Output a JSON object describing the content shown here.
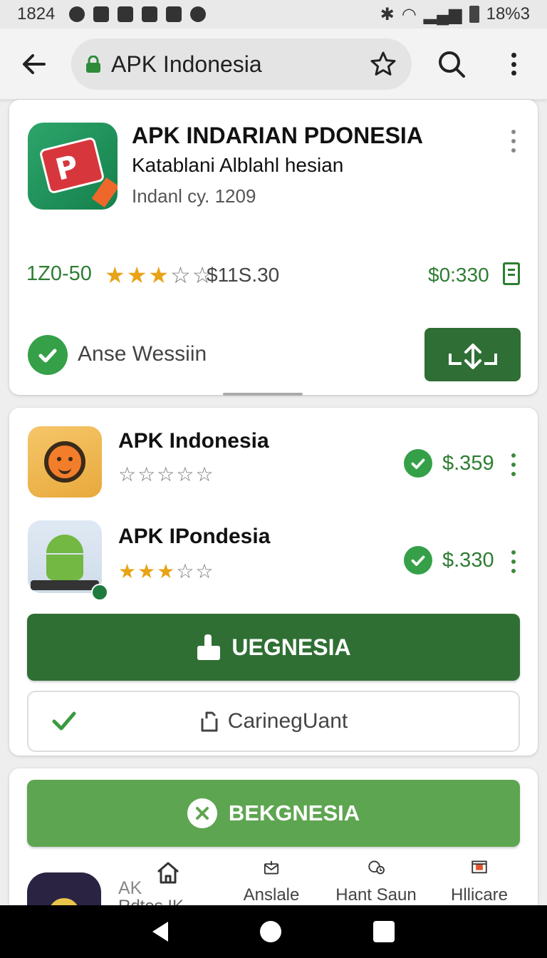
{
  "status_bar": {
    "time": "1824",
    "battery": "18%3"
  },
  "toolbar": {
    "url": "APK Indonesia"
  },
  "featured_app": {
    "title": "APK INDARIAN PDONESIA",
    "subtitle": "Katablani Alblahl hesian",
    "meta": "Indanl cy. 1209",
    "range": "1Z0-50",
    "rating": 3,
    "rating_max": 5,
    "price": "$11S.30",
    "alt_price": "$0:330",
    "status": "Anse Wessiin"
  },
  "app_list": [
    {
      "title": "APK Indonesia",
      "rating": 0,
      "rating_max": 5,
      "price": "$.359"
    },
    {
      "title": "APK IPondesia",
      "rating": 3,
      "rating_max": 5,
      "price": "$.330"
    }
  ],
  "buttons": {
    "primary": "UEGNESIA",
    "secondary": "CarinegUant",
    "cancel": "BEKGNESIA"
  },
  "peek_item": {
    "title": "AK",
    "subtitle": "Rdtes IK"
  },
  "bottom_nav": [
    {
      "label": "",
      "icon": "home-icon"
    },
    {
      "label": "Anslale",
      "icon": "mail-icon"
    },
    {
      "label": "Hant Saun",
      "icon": "clock-icon"
    },
    {
      "label": "Hllicare",
      "icon": "window-icon"
    }
  ],
  "colors": {
    "primary_green": "#2f6f34",
    "light_green": "#5ea551",
    "check_green": "#35a047",
    "star": "#e8a317"
  }
}
